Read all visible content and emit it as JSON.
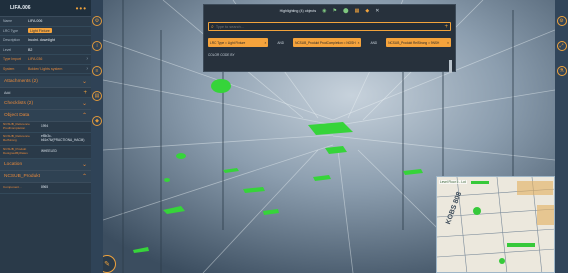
{
  "panel": {
    "title": "LIFA.006",
    "props": [
      {
        "key": "Name",
        "value": "LIFA.006"
      },
      {
        "key": "LRC Type",
        "value": "Light Fixture",
        "chip": true
      },
      {
        "key": "Description",
        "value": "Incdnt. downlight"
      },
      {
        "key": "Level",
        "value": "B2"
      }
    ],
    "dim_props": [
      {
        "key": "Type Import",
        "value": "LIFA.036"
      },
      {
        "key": "System",
        "value": "Bolder/ Lights system"
      }
    ],
    "sections": {
      "attachments": "Attachments (2)",
      "checklists": "Checklists (2)",
      "object_data": "Object Data",
      "location": "Location",
      "ncsub": "NCSUB_Produkt"
    },
    "add_label": "Add",
    "object_data_rows": [
      {
        "key": "NCSUB_Reference ProdCompletion",
        "value": "1994"
      },
      {
        "key": "NCSUB_Reference RelStrong",
        "value": "ef5b3c-b61e76/(PRACTIONA_HACM)"
      },
      {
        "key": "NCSUB_Produkt DesignedByDates",
        "value": "WHEELED"
      }
    ],
    "bottom_row": {
      "key": "Component...",
      "value": "8965"
    }
  },
  "dialog": {
    "title": "Highlighting (4) objects",
    "search_placeholder": "Type to search...",
    "filters": [
      "LRC Type = Light Fixture",
      "NCSUB_Produkt ProdCompletion = NOSH",
      "NCSUB_Produkt RelStrong = 9NSH"
    ],
    "and_label": "AND",
    "color_code_label": "COLOR CODE BY"
  },
  "minimap": {
    "label": "Level Floor 5 - Lot",
    "room_label": "KOBS 808"
  },
  "colors": {
    "accent": "#f5a33c",
    "highlight": "#3ecf3e",
    "panel_bg": "#2a3a49"
  }
}
